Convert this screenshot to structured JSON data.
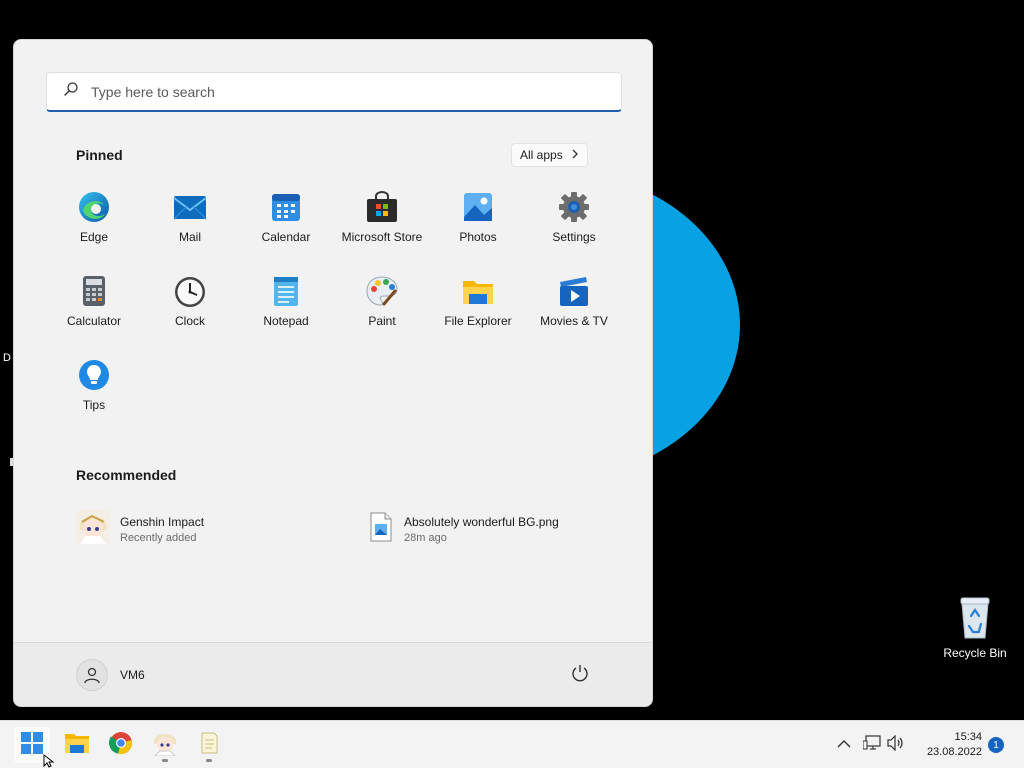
{
  "search": {
    "placeholder": "Type here to search"
  },
  "pinned": {
    "title": "Pinned",
    "all_apps_label": "All apps",
    "apps": [
      {
        "label": "Edge",
        "icon": "edge-icon"
      },
      {
        "label": "Mail",
        "icon": "mail-icon"
      },
      {
        "label": "Calendar",
        "icon": "calendar-icon"
      },
      {
        "label": "Microsoft Store",
        "icon": "store-icon"
      },
      {
        "label": "Photos",
        "icon": "photos-icon"
      },
      {
        "label": "Settings",
        "icon": "gear-icon"
      },
      {
        "label": "Calculator",
        "icon": "calculator-icon"
      },
      {
        "label": "Clock",
        "icon": "clock-icon"
      },
      {
        "label": "Notepad",
        "icon": "notepad-icon"
      },
      {
        "label": "Paint",
        "icon": "palette-icon"
      },
      {
        "label": "File Explorer",
        "icon": "folder-icon"
      },
      {
        "label": "Movies & TV",
        "icon": "movies-icon"
      },
      {
        "label": "Tips",
        "icon": "lightbulb-icon"
      }
    ]
  },
  "recommended": {
    "title": "Recommended",
    "items": [
      {
        "name": "Genshin Impact",
        "detail": "Recently added",
        "icon": "game-avatar-icon"
      },
      {
        "name": "Absolutely wonderful BG.png",
        "detail": "28m ago",
        "icon": "image-file-icon"
      }
    ]
  },
  "user": {
    "name": "VM6"
  },
  "desktop": {
    "recycle_bin_label": "Recycle Bin",
    "stray_text": "D"
  },
  "taskbar": {
    "icons": [
      "windows-start-icon",
      "folder-icon",
      "chrome-icon",
      "game-avatar-icon",
      "notepad-icon"
    ],
    "time": "15:34",
    "date": "23.08.2022",
    "notification_count": "1"
  },
  "colors": {
    "accent": "#1f5fb0",
    "desktop_circle": "#08a2e4",
    "notification": "#1565c0"
  }
}
